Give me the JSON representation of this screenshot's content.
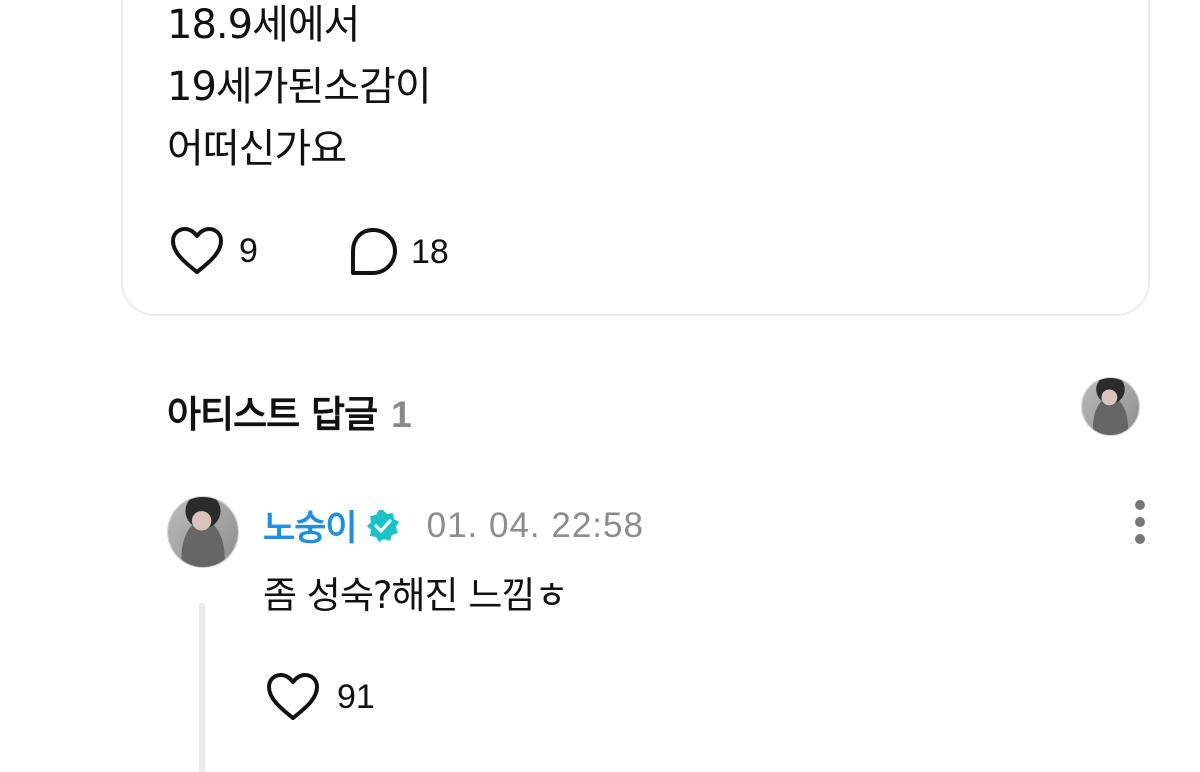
{
  "post": {
    "lines": [
      "18.9세에서",
      "19세가된소감이",
      "어떠신가요"
    ],
    "likes": "9",
    "comments": "18"
  },
  "artist_replies": {
    "title": "아티스트 답글",
    "count": "1"
  },
  "reply": {
    "author": "노숭이",
    "timestamp": "01. 04. 22:58",
    "text": "좀 성숙?해진 느낌ㅎ",
    "likes": "91"
  },
  "colors": {
    "author_blue": "#1e8fe3",
    "verified_teal": "#19c3c6",
    "muted_gray": "#8a8a8a"
  }
}
